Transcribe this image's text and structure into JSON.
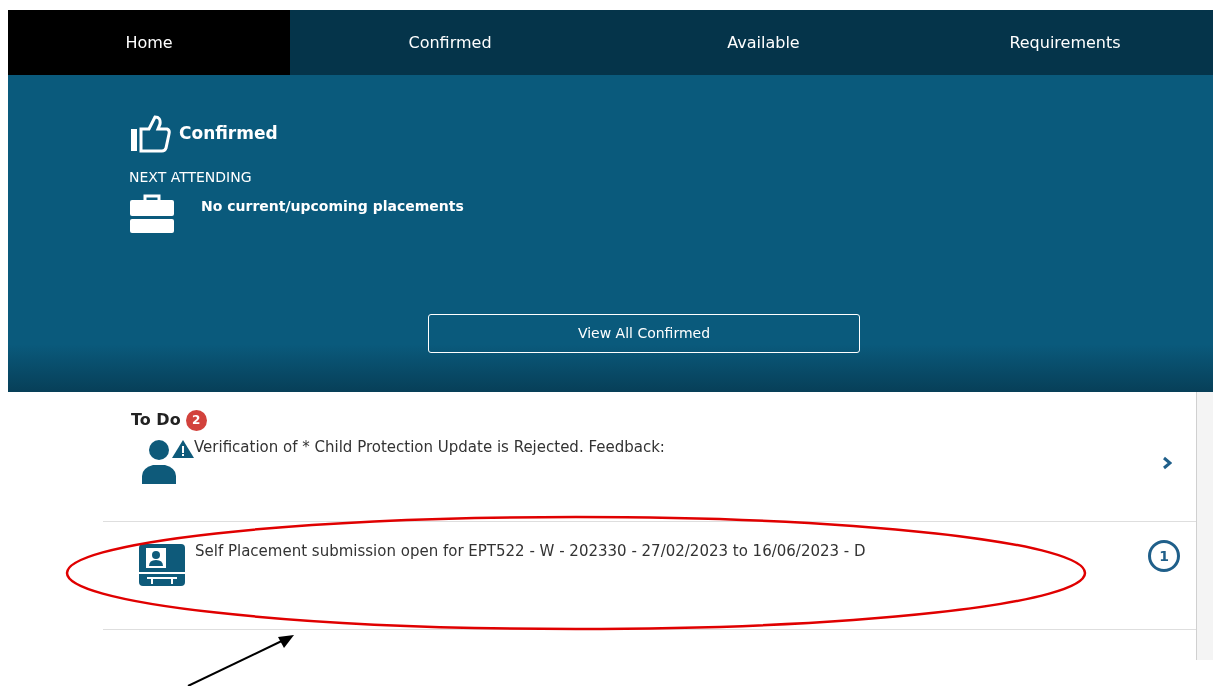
{
  "tabs": [
    {
      "label": "Home",
      "selected": true
    },
    {
      "label": "Confirmed",
      "selected": false
    },
    {
      "label": "Available",
      "selected": false
    },
    {
      "label": "Requirements",
      "selected": false
    }
  ],
  "hero": {
    "title": "Confirmed",
    "section_label": "NEXT ATTENDING",
    "placement_text": "No current/upcoming placements",
    "button": "View All Confirmed"
  },
  "todo": {
    "title": "To Do",
    "count": "2",
    "items": [
      {
        "kind": "warning",
        "text": "Verification of * Child Protection Update is Rejected. Feedback:"
      },
      {
        "kind": "self-placement",
        "text": "Self Placement submission open for EPT522 - W - 202330 - 27/02/2023 to 16/06/2023 - D",
        "badge": "1"
      }
    ]
  }
}
